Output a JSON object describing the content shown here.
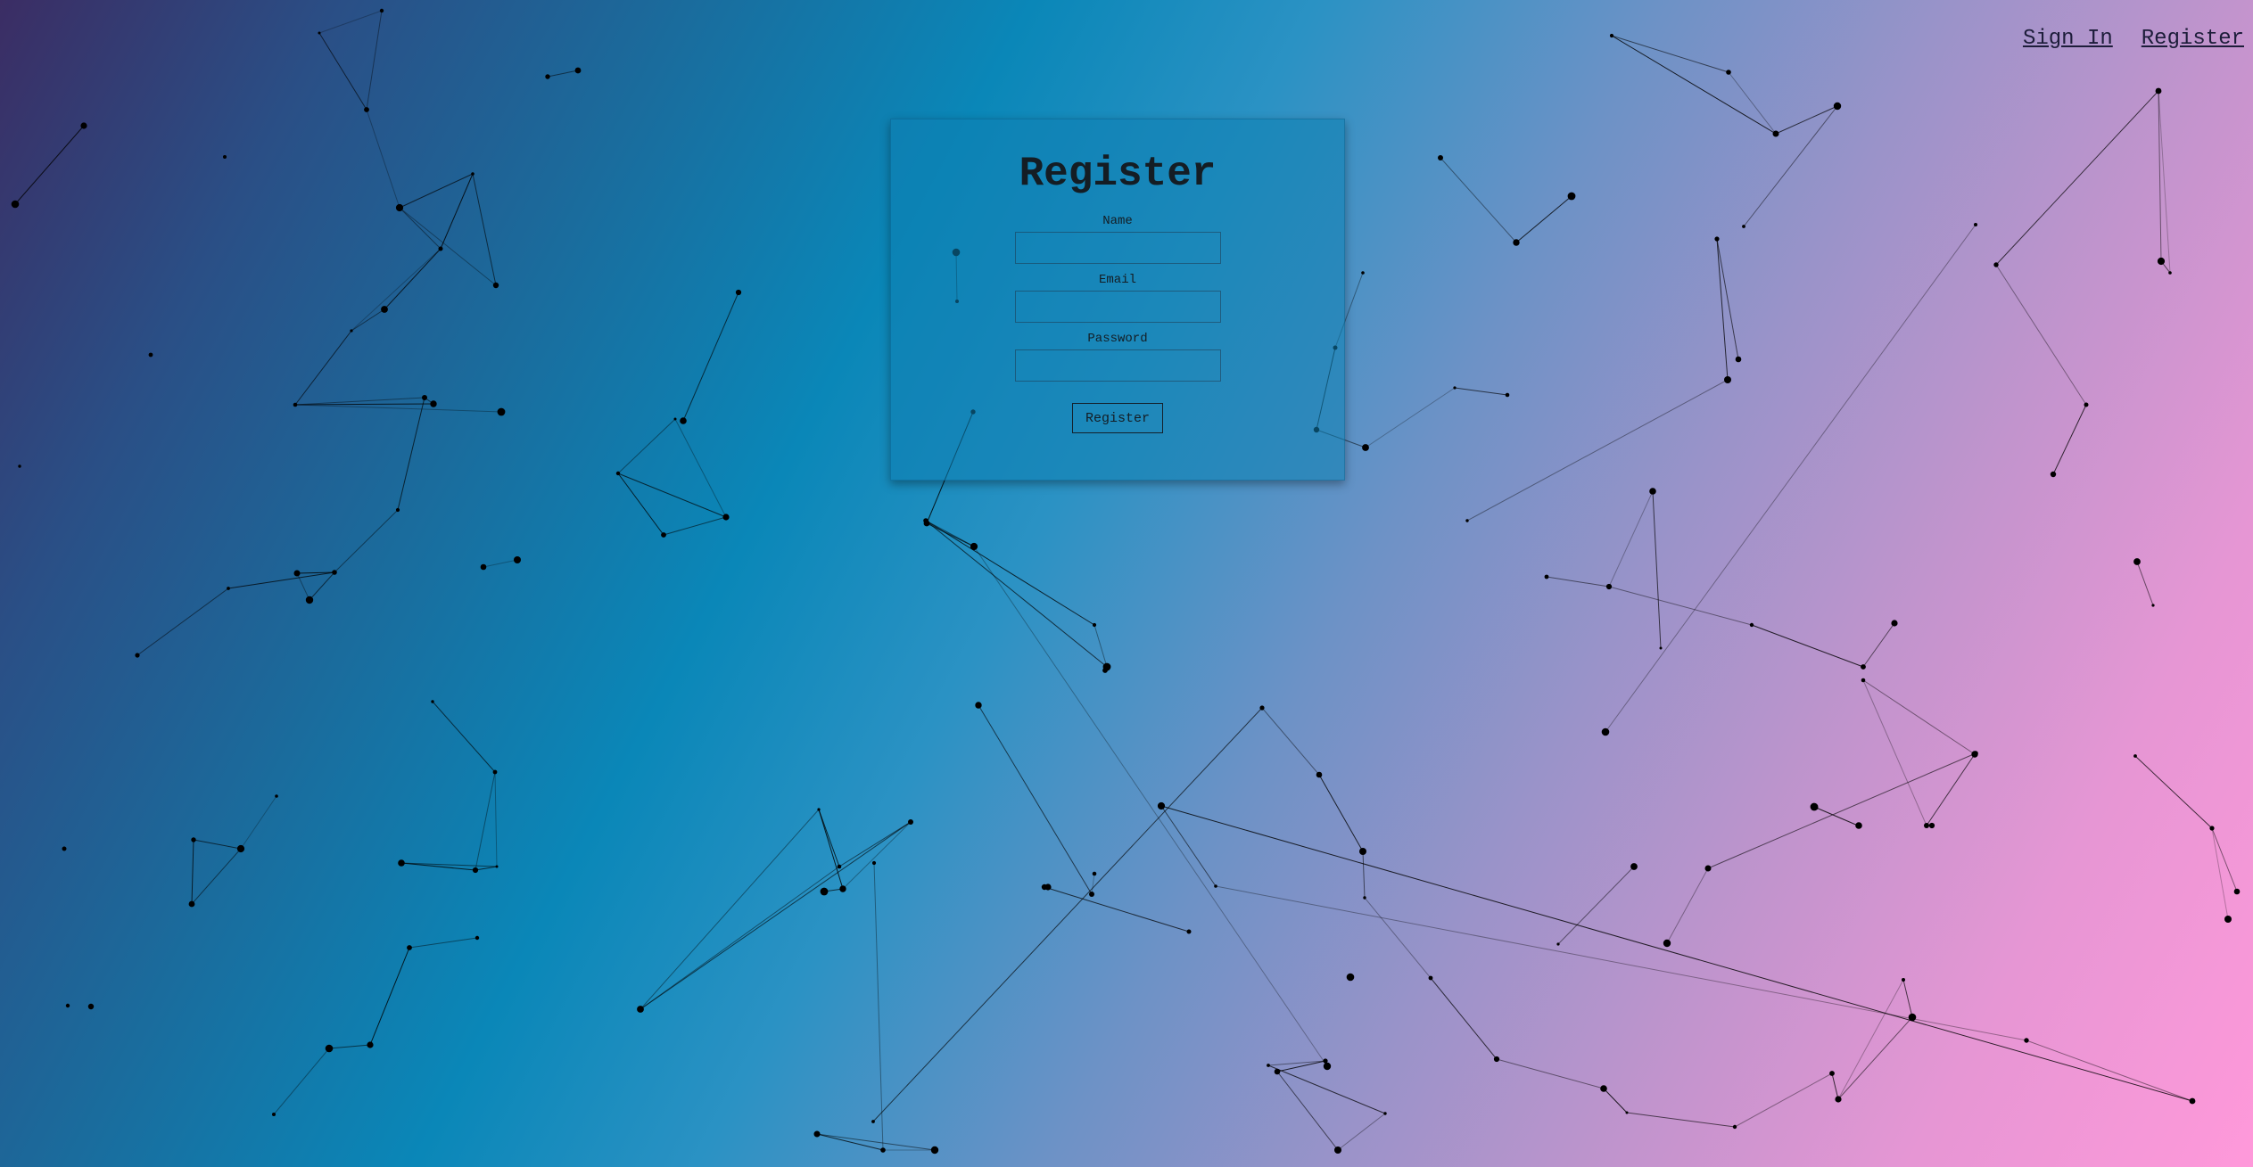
{
  "nav": {
    "sign_in": "Sign In",
    "register": "Register"
  },
  "form": {
    "title": "Register",
    "fields": [
      {
        "label": "Name",
        "value": "",
        "placeholder": ""
      },
      {
        "label": "Email",
        "value": "",
        "placeholder": ""
      },
      {
        "label": "Password",
        "value": "",
        "placeholder": ""
      }
    ],
    "submit_label": "Register"
  },
  "colors": {
    "gradient_start": "#3b2d64",
    "gradient_mid": "#0a87b8",
    "gradient_end": "#ff99da",
    "node_color": "#000000"
  }
}
